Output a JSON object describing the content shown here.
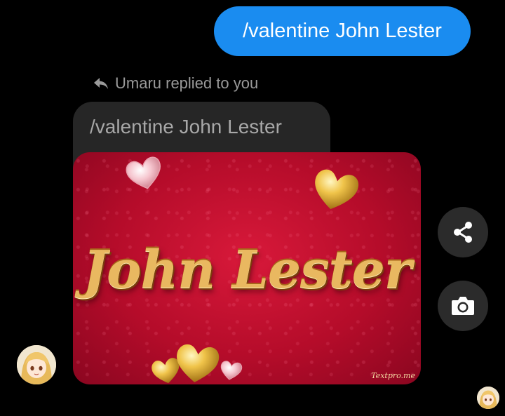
{
  "sent_message": {
    "text": "/valentine John Lester"
  },
  "reply_header": {
    "text": "Umaru replied to you"
  },
  "quoted_message": {
    "text": "/valentine John Lester"
  },
  "image_card": {
    "title": "John Lester",
    "watermark": "Textpro.me"
  },
  "actions": {
    "share_icon": "share-icon",
    "camera_icon": "camera-icon"
  },
  "colors": {
    "sent_bubble": "#1a8cf0",
    "background": "#000000",
    "quoted_bubble": "#262626",
    "card_red": "#c8102e",
    "gold": "#e9b860"
  }
}
